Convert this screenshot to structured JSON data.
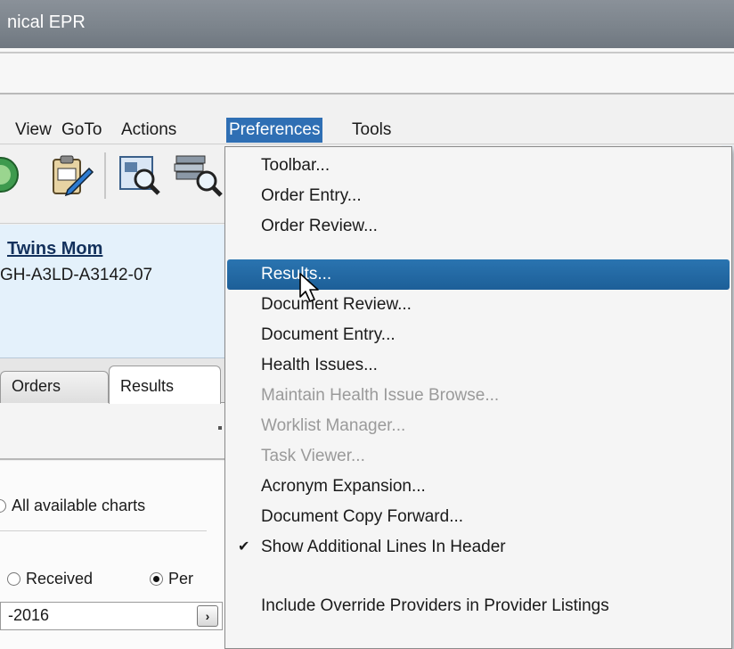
{
  "window": {
    "title": "nical EPR"
  },
  "menubar": {
    "items": [
      {
        "label": "View"
      },
      {
        "label": "GoTo"
      },
      {
        "label": "Actions"
      },
      {
        "label": "Preferences"
      },
      {
        "label": "Tools"
      }
    ],
    "active": "Preferences"
  },
  "toolbar": {
    "icons": [
      "nav-circle-icon",
      "clipboard-edit-icon",
      "search-document-icon",
      "search-stack-icon"
    ]
  },
  "patient": {
    "name": "Twins Mom",
    "mrn": "GH-A3LD-A3142-07"
  },
  "tabs": [
    {
      "label": "Orders"
    },
    {
      "label": "Results"
    }
  ],
  "filters": {
    "charts_option": "All available charts",
    "received_label": "Received",
    "per_label": "Per",
    "date_value": "-2016",
    "date_arrow": "›"
  },
  "dropdown": {
    "items": [
      {
        "label": "Toolbar..."
      },
      {
        "label": "Order Entry..."
      },
      {
        "label": "Order Review..."
      },
      {
        "label": "Results...",
        "state": "hover"
      },
      {
        "label": "Document Review..."
      },
      {
        "label": "Document Entry..."
      },
      {
        "label": "Health Issues..."
      },
      {
        "label": "Maintain Health Issue Browse...",
        "state": "disabled"
      },
      {
        "label": "Worklist Manager...",
        "state": "disabled"
      },
      {
        "label": "Task Viewer...",
        "state": "disabled"
      },
      {
        "label": "Acronym Expansion..."
      },
      {
        "label": "Document Copy Forward..."
      },
      {
        "label": "Show Additional Lines In Header",
        "checked": true,
        "check_glyph": "✔"
      },
      {
        "label": "Include Override Providers in Provider Listings"
      }
    ]
  },
  "colors": {
    "menu_active": "#2f6fb4",
    "item_hover": "#1d5f98",
    "banner": "#e4f1fb"
  }
}
